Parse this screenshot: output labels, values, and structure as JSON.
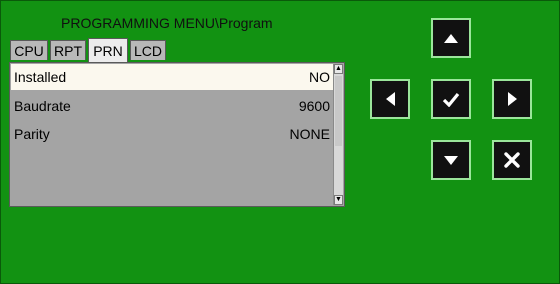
{
  "title": "PROGRAMMING MENU\\Program",
  "tabs": [
    {
      "label": "CPU",
      "active": false
    },
    {
      "label": "RPT",
      "active": false
    },
    {
      "label": "PRN",
      "active": true
    },
    {
      "label": "LCD",
      "active": false
    }
  ],
  "rows": [
    {
      "label": "Installed",
      "value": "NO",
      "selected": true
    },
    {
      "label": "Baudrate",
      "value": "9600",
      "selected": false
    },
    {
      "label": "Parity",
      "value": "NONE",
      "selected": false
    }
  ],
  "nav_icons": {
    "up": "arrow-up-icon",
    "left": "arrow-left-icon",
    "ok": "checkmark-icon",
    "right": "arrow-right-icon",
    "down": "arrow-down-icon",
    "cancel": "cancel-x-icon"
  },
  "colors": {
    "background": "#129212",
    "selected_row": "#fbf8ee",
    "list_background": "#a4a4a4",
    "button_background": "#111111",
    "button_border": "#9be69b"
  }
}
